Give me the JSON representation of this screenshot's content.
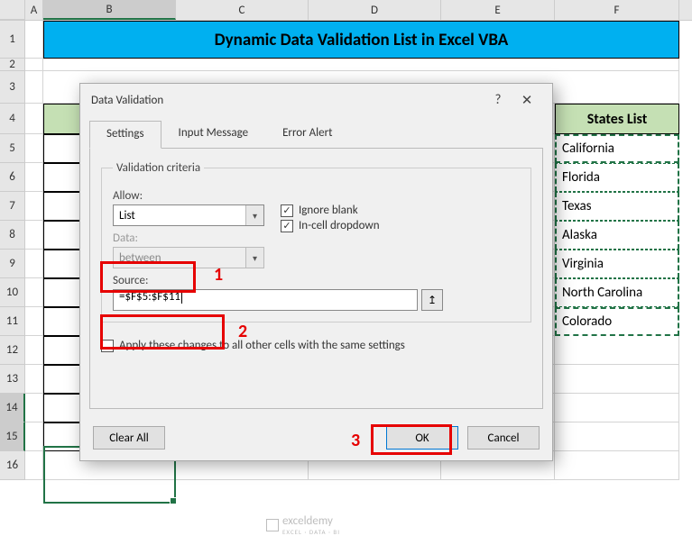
{
  "columns": [
    "A",
    "B",
    "C",
    "D",
    "E",
    "F"
  ],
  "banner_title": "Dynamic Data Validation List in Excel VBA",
  "header_f": "States List",
  "states": [
    "California",
    "Florida",
    "Texas",
    "Alaska",
    "Virginia",
    "North Carolina",
    "Colorado"
  ],
  "dialog": {
    "title": "Data Validation",
    "help": "?",
    "close": "✕",
    "tabs": {
      "settings": "Settings",
      "input": "Input Message",
      "error": "Error Alert"
    },
    "legend": "Validation criteria",
    "allow_label": "Allow:",
    "allow_value": "List",
    "data_label": "Data:",
    "data_value": "between",
    "ignore_blank": "Ignore blank",
    "incell": "In-cell dropdown",
    "source_label": "Source:",
    "source_value": "=$F$5:$F$11",
    "apply_all": "Apply these changes to all other cells with the same settings",
    "clear": "Clear All",
    "ok": "OK",
    "cancel": "Cancel"
  },
  "annotations": {
    "n1": "1",
    "n2": "2",
    "n3": "3"
  },
  "watermark": {
    "name": "exceldemy",
    "tag": "EXCEL · DATA · BI"
  }
}
